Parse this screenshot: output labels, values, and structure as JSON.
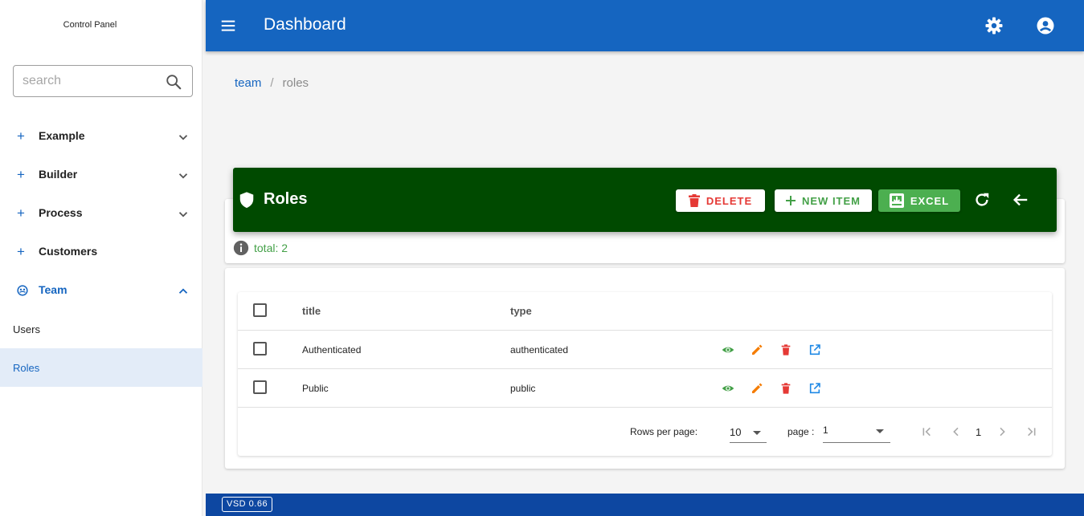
{
  "sidebar": {
    "brand": "Control Panel",
    "search_placeholder": "search",
    "items": [
      {
        "label": "Example"
      },
      {
        "label": "Builder"
      },
      {
        "label": "Process"
      },
      {
        "label": "Customers"
      },
      {
        "label": "Team"
      }
    ],
    "team_children": [
      {
        "label": "Users"
      },
      {
        "label": "Roles"
      }
    ]
  },
  "header": {
    "title": "Dashboard"
  },
  "breadcrumb": {
    "parent": "team",
    "separator": "/",
    "current": "roles"
  },
  "toolbar": {
    "title": "Roles",
    "delete_label": "DELETE",
    "new_item_label": "NEW ITEM",
    "excel_label": "EXCEL",
    "total_text": "total: 2"
  },
  "table": {
    "columns": [
      "title",
      "type"
    ],
    "rows": [
      {
        "title": "Authenticated",
        "type": "authenticated"
      },
      {
        "title": "Public",
        "type": "public"
      }
    ]
  },
  "pagination": {
    "rows_per_page_label": "Rows per page:",
    "rows_per_page_value": "10",
    "page_label": "page :",
    "page_select_value": "1",
    "current_page": "1"
  },
  "footer": {
    "version": "VSD 0.66"
  },
  "colors": {
    "primary": "#1565c0",
    "banner": "#004a00",
    "danger": "#e53935",
    "success": "#43a047",
    "warning": "#f57c00",
    "footer": "#0d47a1"
  },
  "icons": [
    "menu-icon",
    "settings-icon",
    "account-icon",
    "search-icon",
    "shield-icon",
    "trash-icon",
    "plus-icon",
    "excel-icon",
    "refresh-icon",
    "arrow-back-icon",
    "info-icon",
    "eye-icon",
    "pencil-icon",
    "open-external-icon",
    "first-page-icon",
    "prev-page-icon",
    "next-page-icon",
    "last-page-icon",
    "chevron-down-icon",
    "chevron-up-icon",
    "team-icon"
  ]
}
